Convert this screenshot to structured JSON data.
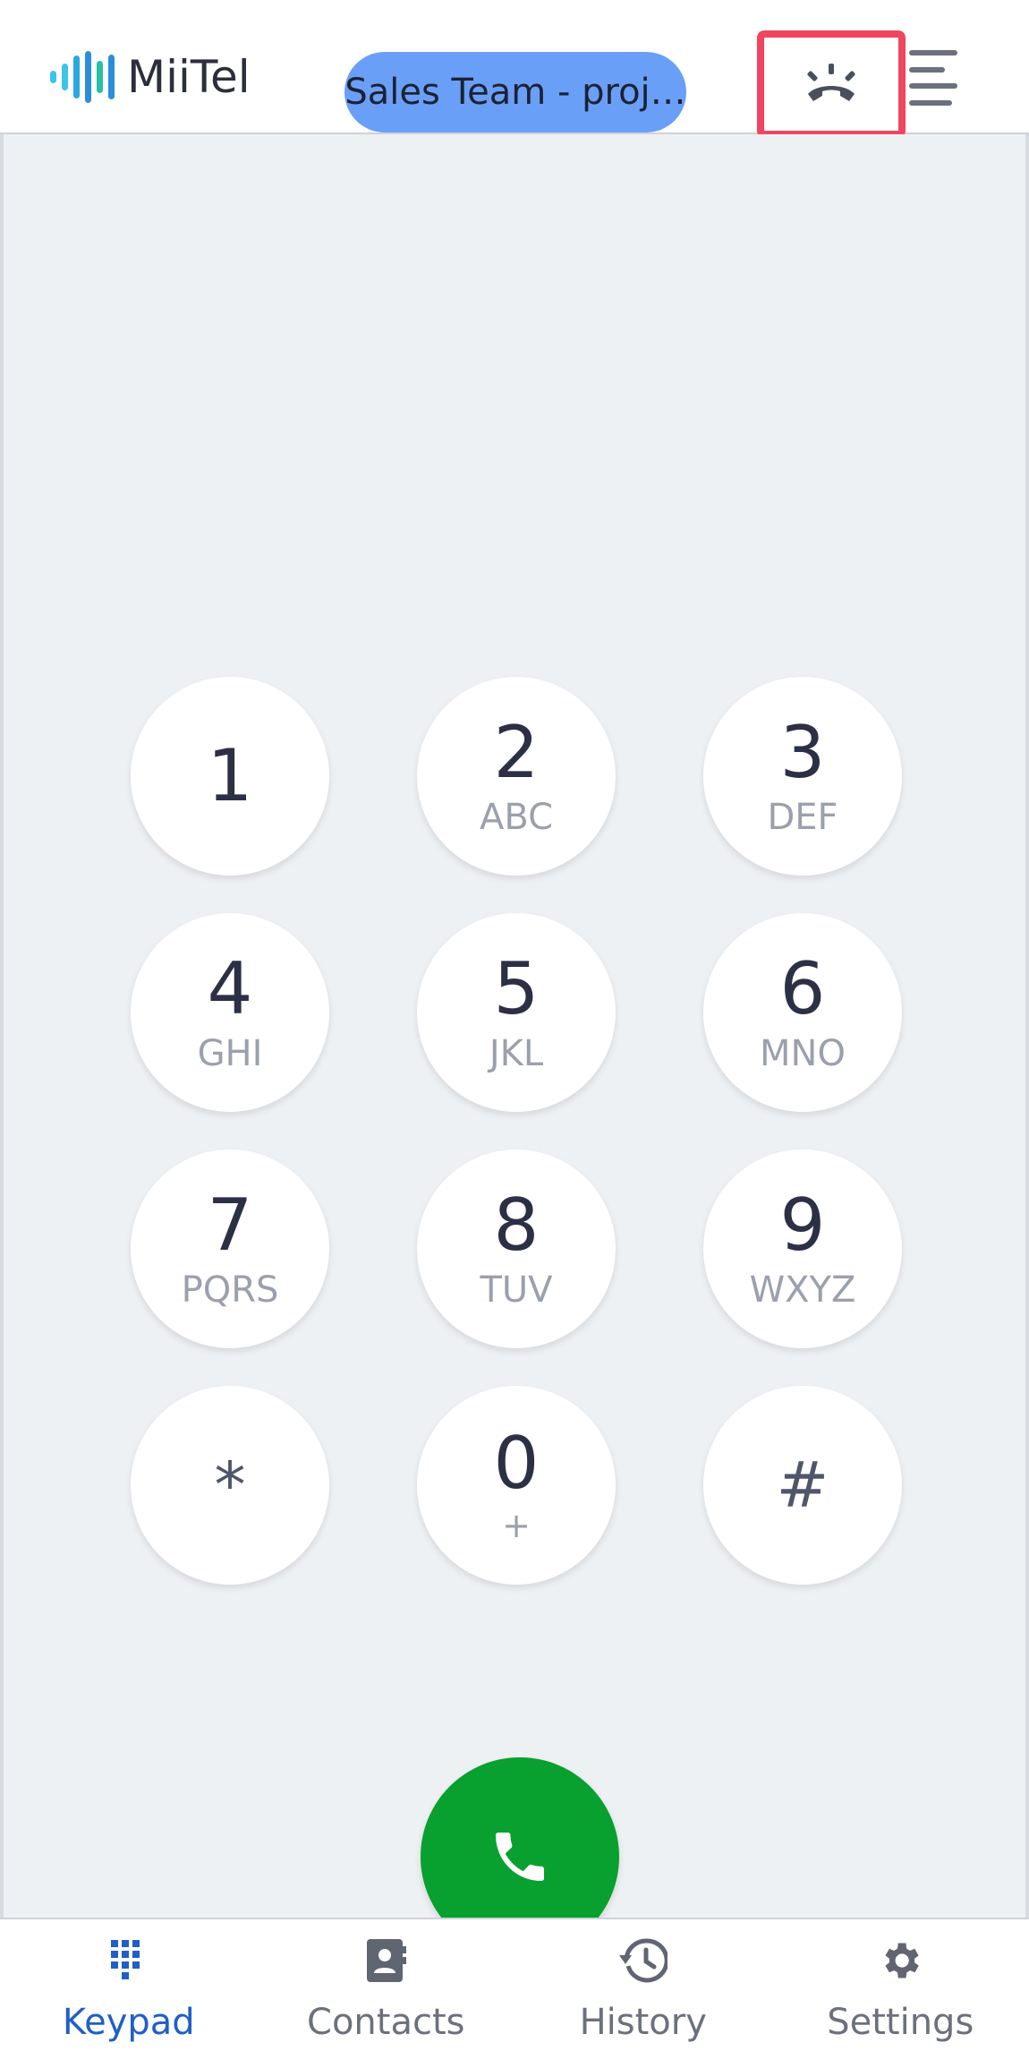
{
  "header": {
    "logo_text": "MiiTel",
    "team_selector": "Sales Team - proj…"
  },
  "keypad": {
    "keys": [
      {
        "digit": "1",
        "letters": ""
      },
      {
        "digit": "2",
        "letters": "ABC"
      },
      {
        "digit": "3",
        "letters": "DEF"
      },
      {
        "digit": "4",
        "letters": "GHI"
      },
      {
        "digit": "5",
        "letters": "JKL"
      },
      {
        "digit": "6",
        "letters": "MNO"
      },
      {
        "digit": "7",
        "letters": "PQRS"
      },
      {
        "digit": "8",
        "letters": "TUV"
      },
      {
        "digit": "9",
        "letters": "WXYZ"
      },
      {
        "digit": "*",
        "letters": ""
      },
      {
        "digit": "0",
        "letters": "+"
      },
      {
        "digit": "#",
        "letters": ""
      }
    ]
  },
  "nav": {
    "items": [
      {
        "label": "Keypad",
        "icon": "keypad-icon",
        "active": true
      },
      {
        "label": "Contacts",
        "icon": "contacts-icon",
        "active": false
      },
      {
        "label": "History",
        "icon": "history-icon",
        "active": false
      },
      {
        "label": "Settings",
        "icon": "settings-icon",
        "active": false
      }
    ]
  },
  "colors": {
    "accent": "#1f5fc6",
    "call": "#08a02e",
    "highlight": "#f0455f",
    "pill": "#6a9ff8"
  }
}
